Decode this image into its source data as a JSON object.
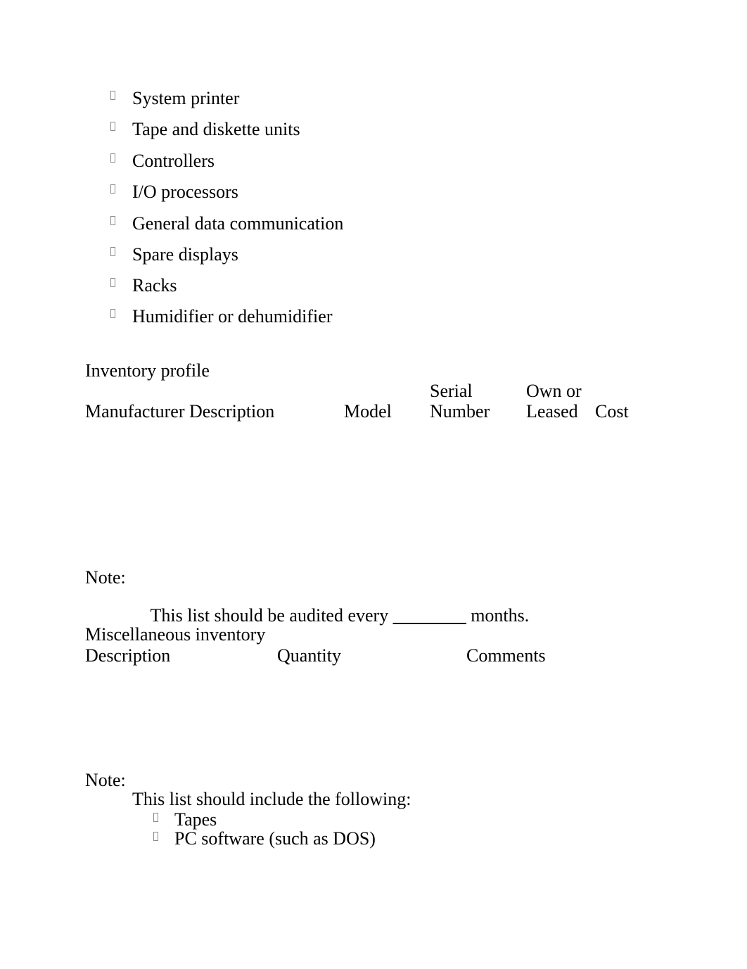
{
  "document": {
    "equipment_list": {
      "items": [
        {
          "bullet": "tofu-box-bullet",
          "label": "System printer"
        },
        {
          "bullet": "tofu-box-bullet",
          "label": "Tape and diskette units"
        },
        {
          "bullet": "tofu-box-bullet",
          "label": "Controllers"
        },
        {
          "bullet": "tofu-box-bullet",
          "label": "I/O processors"
        },
        {
          "bullet": "tofu-box-bullet",
          "label": "General data communication"
        },
        {
          "bullet": "tofu-box-bullet",
          "label": "Spare displays"
        },
        {
          "bullet": "tofu-box-bullet",
          "label": "Racks"
        },
        {
          "bullet": "tofu-box-bullet",
          "label": "Humidifier or dehumidifier"
        }
      ]
    },
    "inventory_profile": {
      "heading": "Inventory profile",
      "columns": [
        {
          "line1": "",
          "line2": "Manufacturer Description"
        },
        {
          "line1": "",
          "line2": "Model"
        },
        {
          "line1": "Serial",
          "line2": "Number"
        },
        {
          "line1": "Own or",
          "line2": "Leased"
        },
        {
          "line1": "",
          "line2": "Cost"
        }
      ],
      "rows": []
    },
    "note_audit": {
      "label": "Note:",
      "text_before_blank": "This list should be audited every ",
      "blank": "________",
      "text_after_blank": " months."
    },
    "miscellaneous_inventory": {
      "heading": "Miscellaneous inventory",
      "columns": [
        "Description",
        "Quantity",
        "Comments"
      ],
      "rows": []
    },
    "note_include": {
      "label": "Note:",
      "text": "This list should include the following:",
      "items": [
        {
          "bullet": "tofu-box-bullet",
          "label": "Tapes"
        },
        {
          "bullet": "tofu-box-bullet",
          "label": "PC software (such as DOS)"
        }
      ]
    }
  }
}
